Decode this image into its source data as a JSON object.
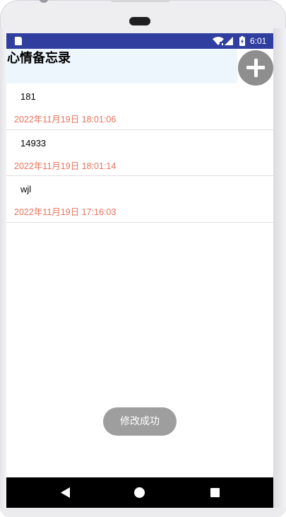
{
  "status_bar": {
    "time": "6:01",
    "icons": [
      "sd-card-icon",
      "wifi-icon",
      "signal-icon",
      "battery-icon"
    ]
  },
  "header": {
    "title": "心情备忘录",
    "background": "#eef6fd"
  },
  "add_button": {
    "icon": "plus-icon",
    "color": "#8e8e8e"
  },
  "memos": [
    {
      "content": "181",
      "time": "2022年11月19日 18:01:06"
    },
    {
      "content": "14933",
      "time": "2022年11月19日 18:01:14"
    },
    {
      "content": "wjl",
      "time": "2022年11月19日 17:16:03"
    }
  ],
  "toast": {
    "text": "修改成功"
  },
  "colors": {
    "status_bar": "#303f9f",
    "timestamp": "#e8735b",
    "nav_bar": "#000000"
  },
  "nav": {
    "icons": [
      "back-icon",
      "home-icon",
      "recents-icon"
    ]
  }
}
